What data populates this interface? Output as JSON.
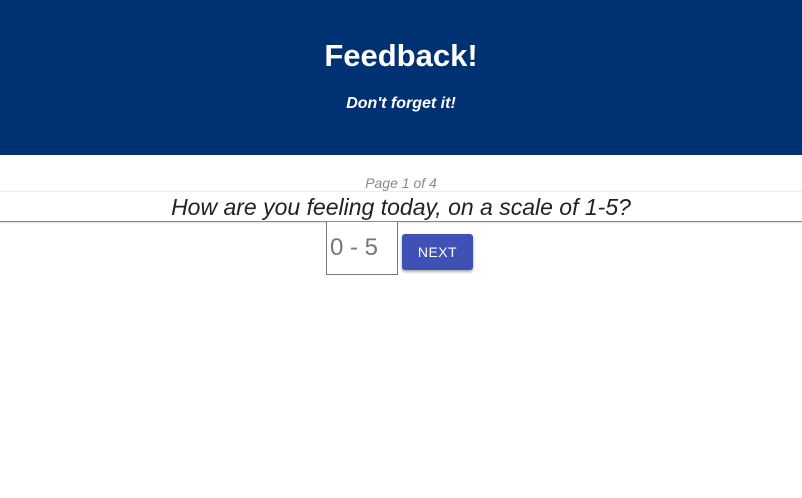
{
  "header": {
    "title": "Feedback!",
    "subtitle": "Don't forget it!",
    "background_color": "#003173"
  },
  "survey": {
    "page_indicator": "Page 1 of 4",
    "question": "How are you feeling today, on a scale of 1-5?",
    "answer_input": {
      "value": "",
      "placeholder": "0 - 5"
    },
    "next_button_label": "NEXT",
    "accent_color": "#3f51b5"
  }
}
